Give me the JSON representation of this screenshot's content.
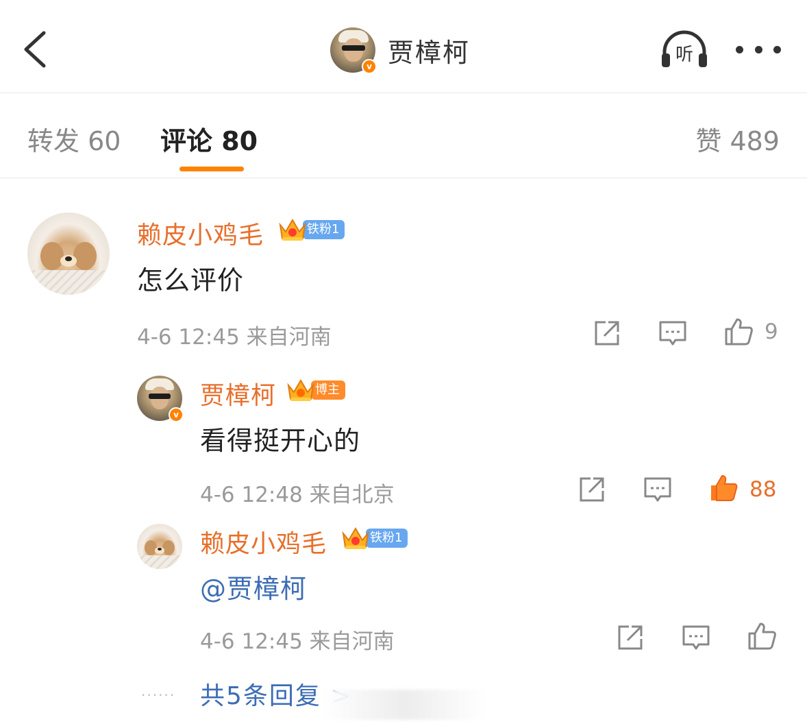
{
  "header": {
    "title": "贾樟柯",
    "verified_badge": "v",
    "listen_label": "听"
  },
  "tabs": {
    "repost": "转发 60",
    "comment": "评论 80",
    "like": "赞 489"
  },
  "comments": [
    {
      "user": "赖皮小鸡毛",
      "badge": "铁粉1",
      "text": "怎么评价",
      "meta": "4-6 12:45 来自河南",
      "likes": "9"
    },
    {
      "user": "贾樟柯",
      "badge": "博主",
      "text": "看得挺开心的",
      "meta": "4-6 12:48 来自北京",
      "likes": "88"
    },
    {
      "user": "赖皮小鸡毛",
      "badge": "铁粉1",
      "text": "@贾樟柯",
      "meta": "4-6 12:45 来自河南",
      "likes": ""
    }
  ],
  "more_replies": "共5条回复 >",
  "colors": {
    "accent": "#ff8200",
    "name": "#e86f2b",
    "link": "#3d6db5",
    "meta": "#9a9a9a"
  }
}
